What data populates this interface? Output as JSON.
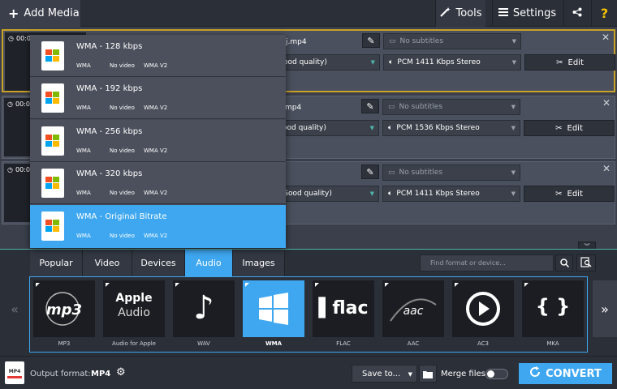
{
  "toolbar": {
    "add_media": "Add Media",
    "tools": "Tools",
    "settings": "Settings",
    "help": "?"
  },
  "files": [
    {
      "duration": "00:0",
      "name_partial": "j.mp4",
      "subtitles": "No subtitles",
      "quality_partial": "ood quality)",
      "audio": "PCM 1411 Kbps Stereo",
      "edit": "Edit",
      "selected": true
    },
    {
      "duration": "00:0",
      "name_partial": "mp4",
      "subtitles": "No subtitles",
      "quality_partial": "ood quality)",
      "audio": "PCM 1536 Kbps Stereo",
      "edit": "Edit",
      "selected": false
    },
    {
      "duration": "00:0",
      "name_partial": "",
      "subtitles": "No subtitles",
      "quality_partial": "Good quality)",
      "audio": "PCM 1411 Kbps Stereo",
      "edit": "Edit",
      "selected": false
    }
  ],
  "dropdown": {
    "items": [
      {
        "title": "WMA - 128 kbps",
        "c1": "WMA",
        "c2": "No video",
        "c3": "WMA V2"
      },
      {
        "title": "WMA - 192 kbps",
        "c1": "WMA",
        "c2": "No video",
        "c3": "WMA V2"
      },
      {
        "title": "WMA - 256 kbps",
        "c1": "WMA",
        "c2": "No video",
        "c3": "WMA V2"
      },
      {
        "title": "WMA - 320 kbps",
        "c1": "WMA",
        "c2": "No video",
        "c3": "WMA V2"
      },
      {
        "title": "WMA - Original Bitrate",
        "c1": "WMA",
        "c2": "No video",
        "c3": "WMA V2"
      }
    ],
    "active_index": 4
  },
  "tabs": [
    "Popular",
    "Video",
    "Devices",
    "Audio",
    "Images"
  ],
  "active_tab": "Audio",
  "search": {
    "placeholder": "Find format or device..."
  },
  "formats": [
    {
      "label": "MP3",
      "logo": "mp3"
    },
    {
      "label": "Audio for Apple",
      "logo": "Apple Audio"
    },
    {
      "label": "WAV",
      "logo": "music-note"
    },
    {
      "label": "WMA",
      "logo": "windows"
    },
    {
      "label": "FLAC",
      "logo": "flac"
    },
    {
      "label": "AAC",
      "logo": "aac"
    },
    {
      "label": "AC3",
      "logo": "play-circle"
    },
    {
      "label": "MKA",
      "logo": "{ }"
    }
  ],
  "active_format": "WMA",
  "bottom": {
    "output_label": "Output format:",
    "output_value": "MP4",
    "output_icon_text": "MP4",
    "save_to": "Save to...",
    "merge_label": "Merge files:",
    "convert": "CONVERT"
  },
  "colors": {
    "accent": "#3ea7f0",
    "selection_border": "#c9a227",
    "help": "#f2c200"
  }
}
